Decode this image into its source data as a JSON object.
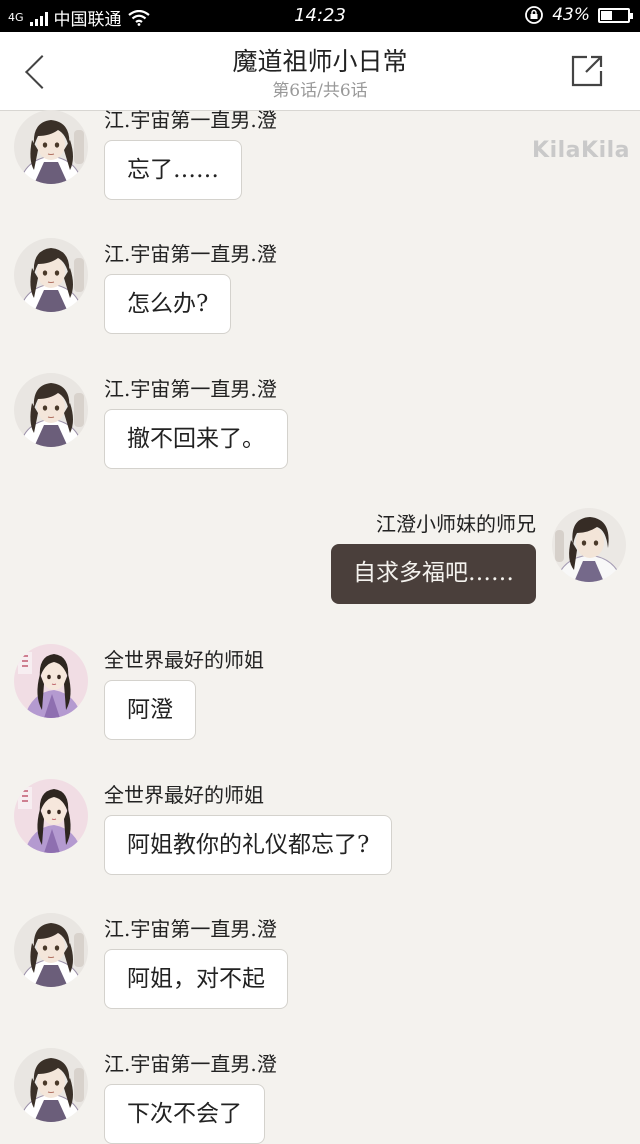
{
  "status_bar": {
    "network": "4G",
    "carrier": "中国联通",
    "time": "14:23",
    "battery": "43%",
    "battery_level": 0.43
  },
  "header": {
    "title": "魔道祖师小日常",
    "subtitle": "第6话/共6话"
  },
  "watermark": "KilaKila",
  "colors": {
    "background": "#f4f2ee",
    "bubble_other": "#ffffff",
    "bubble_self": "#4a3f3b"
  },
  "messages": [
    {
      "side": "left",
      "avatar": "avatar-jiang-cheng",
      "name": "江.宇宙第一直男.澄",
      "text": "忘了……"
    },
    {
      "side": "left",
      "avatar": "avatar-jiang-cheng",
      "name": "江.宇宙第一直男.澄",
      "text": "怎么办?"
    },
    {
      "side": "left",
      "avatar": "avatar-jiang-cheng",
      "name": "江.宇宙第一直男.澄",
      "text": "撤不回来了。"
    },
    {
      "side": "right",
      "avatar": "avatar-senior-brother",
      "name": "江澄小师妹的师兄",
      "text": "自求多福吧……"
    },
    {
      "side": "left",
      "avatar": "avatar-shijie",
      "name": "全世界最好的师姐",
      "text": "阿澄"
    },
    {
      "side": "left",
      "avatar": "avatar-shijie",
      "name": "全世界最好的师姐",
      "text": "阿姐教你的礼仪都忘了?"
    },
    {
      "side": "left",
      "avatar": "avatar-jiang-cheng",
      "name": "江.宇宙第一直男.澄",
      "text": "阿姐，对不起"
    },
    {
      "side": "left",
      "avatar": "avatar-jiang-cheng",
      "name": "江.宇宙第一直男.澄",
      "text": "下次不会了"
    }
  ]
}
